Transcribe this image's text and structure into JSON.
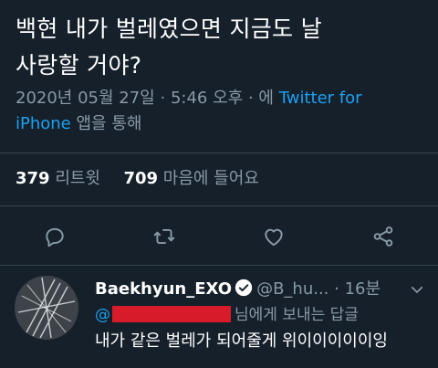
{
  "tweet": {
    "text_line1": "백현 내가 벌레였으면 지금도 날",
    "text_line2": "사랑할 거야?",
    "date": "2020년 05월 27일",
    "time": "5:46 오후",
    "via_prefix": "에",
    "source_line1": "Twitter for",
    "source_line2": "iPhone",
    "via_suffix": "앱을 통해"
  },
  "stats": {
    "retweets_count": "379",
    "retweets_label": "리트윗",
    "likes_count": "709",
    "likes_label": "마음에 들어요"
  },
  "actions": {
    "reply_icon": "reply-icon",
    "retweet_icon": "retweet-icon",
    "like_icon": "heart-icon",
    "share_icon": "share-icon"
  },
  "reply": {
    "name": "Baekhyun_EXO",
    "handle": "@B_hu...",
    "separator": "·",
    "time": "16분",
    "mention_prefix": "@",
    "replying_suffix": "님에게 보내는 답글",
    "body": "내가 같은 벌레가 되어줄게 위이이이이이잉"
  },
  "colors": {
    "background": "#15202b",
    "muted": "#8899a6",
    "accent": "#1da1f2",
    "divider": "#38444d"
  }
}
